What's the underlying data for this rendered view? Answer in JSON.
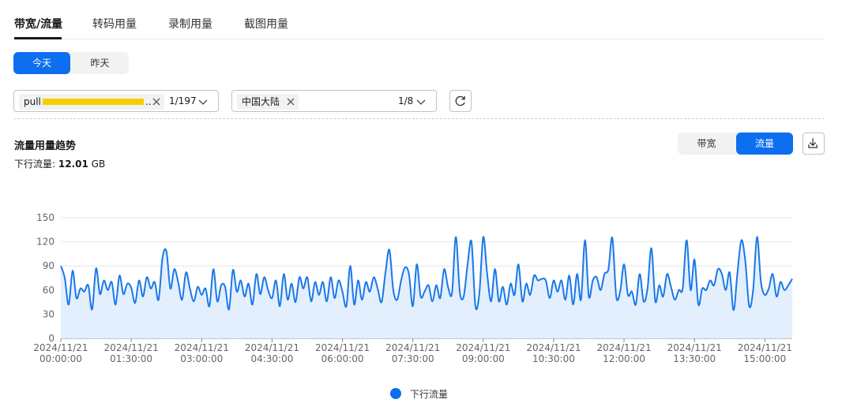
{
  "tabs": [
    {
      "label": "带宽/流量",
      "active": true
    },
    {
      "label": "转码用量",
      "active": false
    },
    {
      "label": "录制用量",
      "active": false
    },
    {
      "label": "截图用量",
      "active": false
    }
  ],
  "day_toggle": {
    "today": "今天",
    "yesterday": "昨天",
    "selected": "今天"
  },
  "filters": {
    "stream": {
      "chip": "pull",
      "chip_suffix": "..",
      "count": "1/197"
    },
    "region": {
      "chip": "中国大陆",
      "count": "1/8"
    }
  },
  "section": {
    "title": "流量用量趋势",
    "summary_label": "下行流量:",
    "summary_value": "12.01",
    "summary_unit": "GB"
  },
  "metric_toggle": {
    "bandwidth": "带宽",
    "traffic": "流量",
    "selected": "流量"
  },
  "icons": {
    "refresh": "refresh-icon",
    "download": "download-icon",
    "close": "close-icon",
    "chevron": "chevron-down-icon"
  },
  "colors": {
    "accent": "#0d6ef0",
    "line": "#1a78e8",
    "area": "#e3effd",
    "redaction": "#f7cf00"
  },
  "chart_data": {
    "type": "area",
    "title": "",
    "xlabel": "",
    "ylabel": "",
    "ylim": [
      0,
      150
    ],
    "yticks": [
      0,
      30,
      60,
      90,
      120,
      150
    ],
    "grid": true,
    "legend_position": "bottom",
    "x_range": [
      "2024/11/21 00:00:00",
      "2024/11/21 15:40:00"
    ],
    "x_tick_labels": [
      [
        "2024/11/21",
        "00:00:00"
      ],
      [
        "2024/11/21",
        "01:30:00"
      ],
      [
        "2024/11/21",
        "03:00:00"
      ],
      [
        "2024/11/21",
        "04:30:00"
      ],
      [
        "2024/11/21",
        "06:00:00"
      ],
      [
        "2024/11/21",
        "07:30:00"
      ],
      [
        "2024/11/21",
        "09:00:00"
      ],
      [
        "2024/11/21",
        "10:30:00"
      ],
      [
        "2024/11/21",
        "12:00:00"
      ],
      [
        "2024/11/21",
        "13:30:00"
      ],
      [
        "2024/11/21",
        "15:00:00"
      ]
    ],
    "series": [
      {
        "name": "下行流量",
        "interval_minutes": 5,
        "values": [
          90,
          75,
          42,
          84,
          50,
          62,
          58,
          66,
          36,
          87,
          55,
          72,
          60,
          70,
          42,
          78,
          55,
          68,
          63,
          44,
          72,
          52,
          76,
          62,
          70,
          48,
          100,
          108,
          62,
          86,
          70,
          48,
          82,
          62,
          46,
          64,
          54,
          62,
          40,
          86,
          46,
          66,
          64,
          36,
          85,
          58,
          72,
          52,
          68,
          42,
          80,
          55,
          76,
          60,
          50,
          72,
          40,
          80,
          48,
          68,
          45,
          76,
          62,
          76,
          46,
          70,
          54,
          70,
          46,
          76,
          50,
          72,
          58,
          40,
          90,
          42,
          72,
          48,
          70,
          58,
          76,
          62,
          45,
          82,
          110,
          60,
          48,
          72,
          88,
          80,
          40,
          92,
          52,
          58,
          66,
          46,
          66,
          50,
          86,
          64,
          56,
          126,
          58,
          52,
          92,
          120,
          40,
          56,
          126,
          80,
          46,
          86,
          46,
          64,
          42,
          68,
          54,
          92,
          46,
          68,
          54,
          78,
          72,
          74,
          72,
          50,
          72,
          58,
          72,
          48,
          78,
          42,
          80,
          48,
          122,
          52,
          72,
          76,
          60,
          80,
          86,
          125,
          52,
          58,
          92,
          54,
          58,
          42,
          80,
          46,
          62,
          112,
          46,
          66,
          52,
          80,
          64,
          48,
          60,
          62,
          122,
          60,
          98,
          42,
          62,
          60,
          72,
          66,
          86,
          80,
          60,
          82,
          35,
          82,
          122,
          96,
          40,
          60,
          126,
          70,
          54,
          62,
          80,
          52,
          70,
          60,
          66,
          74
        ]
      }
    ]
  }
}
